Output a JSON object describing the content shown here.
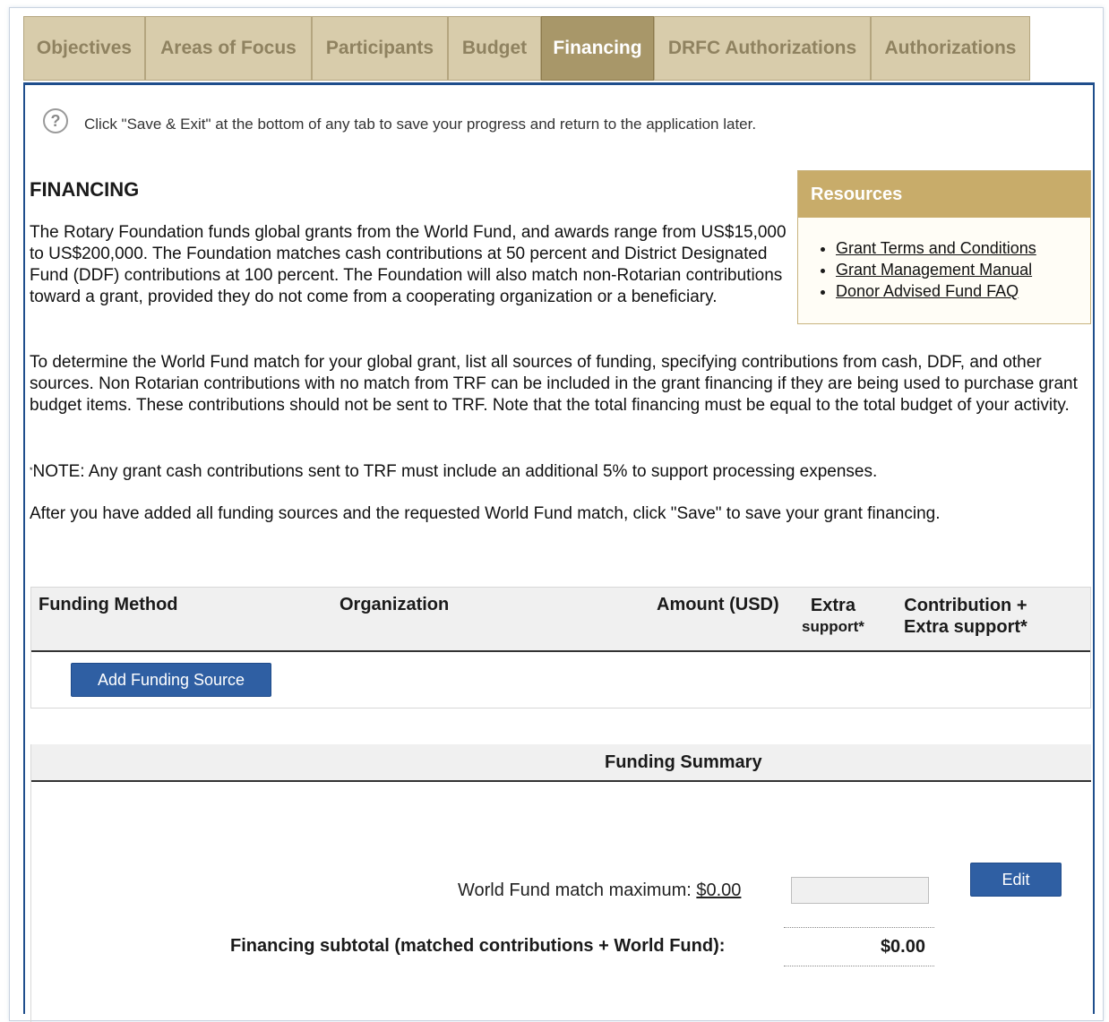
{
  "tabs": [
    {
      "label": "Objectives",
      "active": false
    },
    {
      "label": "Areas of Focus",
      "active": false
    },
    {
      "label": "Participants",
      "active": false
    },
    {
      "label": "Budget",
      "active": false
    },
    {
      "label": "Financing",
      "active": true
    },
    {
      "label": "DRFC Authorizations",
      "active": false
    },
    {
      "label": "Authorizations",
      "active": false
    }
  ],
  "help": {
    "icon": "question-circle-icon",
    "text": "Click \"Save & Exit\" at the bottom of any tab to save your progress and return to the application later."
  },
  "section": {
    "title": "FINANCING",
    "paragraph1": "The Rotary Foundation funds global grants from the World Fund, and awards range from US$15,000 to US$200,000. The Foundation matches cash contributions at 50 percent and District Designated Fund (DDF) contributions at 100 percent. The Foundation will also match non-Rotarian contributions toward a grant, provided they do not come from a cooperating organization or a beneficiary.",
    "paragraph2": "To determine the World Fund match for your global grant, list all sources of funding, specifying contributions from cash, DDF, and other sources. Non Rotarian contributions with no match from TRF can be included in the grant financing if they are being used to purchase grant budget items. These contributions should not be sent to TRF. Note that the total financing must be equal to the total budget of your activity.",
    "note_marker": "*",
    "note": "NOTE: Any grant cash contributions sent to TRF must include an additional 5% to support processing expenses.",
    "paragraph3": "After you have added all funding sources and the requested World Fund match, click \"Save\" to save your grant financing."
  },
  "resources": {
    "title": "Resources",
    "links": [
      "Grant Terms and Conditions",
      "Grant Management Manual",
      "Donor Advised Fund FAQ"
    ]
  },
  "funding_table": {
    "columns": {
      "method": "Funding Method",
      "organization": "Organization",
      "amount": "Amount (USD)",
      "extra_line1": "Extra",
      "extra_line2": "support*",
      "contrib_line1": "Contribution +",
      "contrib_line2": "Extra support*"
    },
    "add_button": "Add Funding Source"
  },
  "summary": {
    "title": "Funding Summary",
    "world_fund_label": "World Fund match maximum:",
    "world_fund_value": "$0.00",
    "world_fund_input": "",
    "edit_button": "Edit",
    "subtotal_label": "Financing subtotal (matched contributions + World Fund):",
    "subtotal_value": "$0.00"
  },
  "colors": {
    "tab_bg": "#d8ccab",
    "tab_active_bg": "#a89769",
    "panel_border": "#1f4e8c",
    "button_bg": "#2f5fa3",
    "resources_header": "#c8ac6a"
  }
}
